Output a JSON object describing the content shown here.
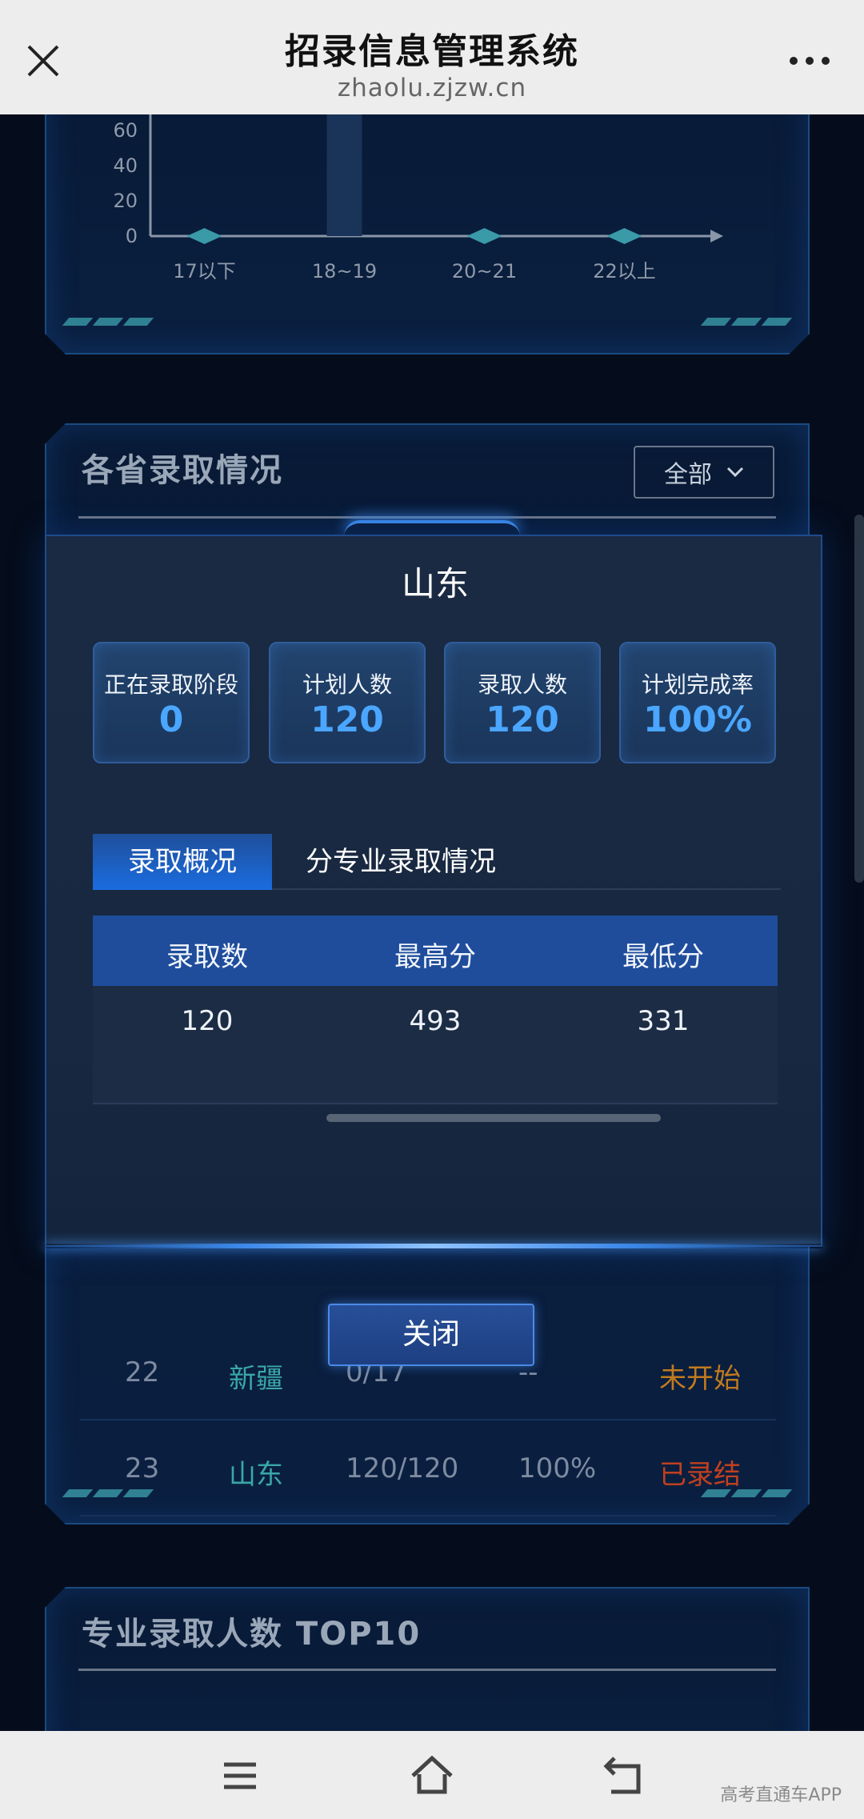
{
  "browser": {
    "title": "招录信息管理系统",
    "url": "zhaolu.zjzw.cn",
    "close_icon": "close-icon",
    "more_icon": "more-dots-icon"
  },
  "age_chart": {
    "chart_data": {
      "type": "line",
      "categories": [
        "17以下",
        "18~19",
        "20~21",
        "22以上"
      ],
      "values": [
        1,
        140,
        5,
        1
      ],
      "ytick_labels": [
        "0",
        "20",
        "40",
        "60"
      ],
      "yticks": [
        0,
        20,
        40,
        60
      ],
      "title": "",
      "xlabel": "",
      "ylabel": ""
    }
  },
  "province_panel": {
    "title": "各省录取情况",
    "filter_label": "全部",
    "rows": [
      {
        "rank": "22",
        "province": "新疆",
        "count": "0/17",
        "rate": "--",
        "status": "未开始",
        "status_color": "#c07a1e"
      },
      {
        "rank": "23",
        "province": "山东",
        "count": "120/120",
        "rate": "100%",
        "status": "已录结",
        "status_color": "#c0401e"
      }
    ]
  },
  "modal": {
    "title": "山东",
    "stats": [
      {
        "label": "正在录取阶段",
        "value": "0"
      },
      {
        "label": "计划人数",
        "value": "120"
      },
      {
        "label": "录取人数",
        "value": "120"
      },
      {
        "label": "计划完成率",
        "value": "100%"
      }
    ],
    "tabs": {
      "active": "录取概况",
      "inactive": "分专业录取情况"
    },
    "table": {
      "headers": [
        "录取数",
        "最高分",
        "最低分"
      ],
      "row": [
        "120",
        "493",
        "331"
      ]
    },
    "close_label": "关闭"
  },
  "top10_panel": {
    "title": "专业录取人数 TOP10"
  },
  "bottom_nav": {
    "watermark": "高考直通车APP"
  },
  "colors": {
    "accent_blue": "#4aa6ff",
    "panel_bg": "#0a1f40",
    "teal": "#3aa7a8"
  }
}
